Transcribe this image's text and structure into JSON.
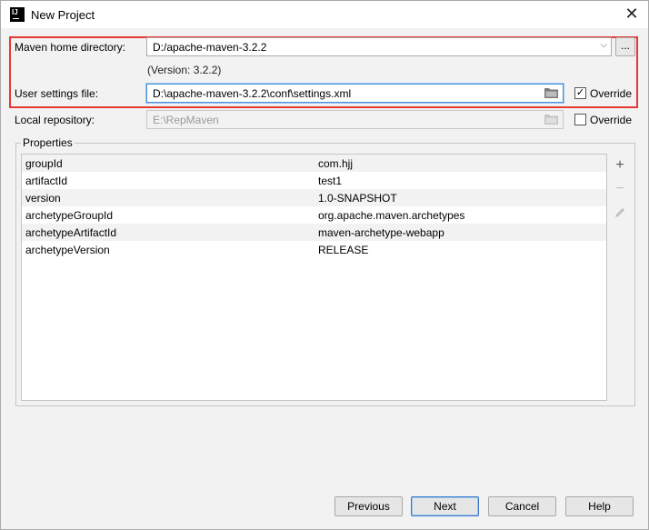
{
  "window": {
    "title": "New Project",
    "icon_text": "IJ",
    "close_glyph": "✕"
  },
  "maven_home": {
    "label": "Maven home directory:",
    "value": "D:/apache-maven-3.2.2",
    "version_text": "(Version: 3.2.2)",
    "browse_label": "..."
  },
  "user_settings": {
    "label": "User settings file:",
    "value": "D:\\apache-maven-3.2.2\\conf\\settings.xml",
    "override_label": "Override",
    "override_checked": true
  },
  "local_repo": {
    "label": "Local repository:",
    "value": "E:\\RepMaven",
    "override_label": "Override",
    "override_checked": false
  },
  "properties": {
    "label": "Properties",
    "rows": [
      {
        "key": "groupId",
        "value": "com.hjj"
      },
      {
        "key": "artifactId",
        "value": "test1"
      },
      {
        "key": "version",
        "value": "1.0-SNAPSHOT"
      },
      {
        "key": "archetypeGroupId",
        "value": "org.apache.maven.archetypes"
      },
      {
        "key": "archetypeArtifactId",
        "value": "maven-archetype-webapp"
      },
      {
        "key": "archetypeVersion",
        "value": "RELEASE"
      }
    ]
  },
  "buttons": {
    "previous": "Previous",
    "next": "Next",
    "cancel": "Cancel",
    "help": "Help"
  },
  "colors": {
    "highlight": "#e53935",
    "focus": "#4a90d9"
  }
}
